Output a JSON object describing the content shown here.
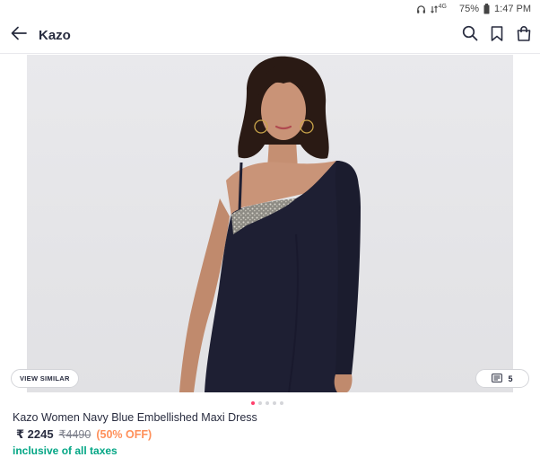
{
  "status_bar": {
    "network": "4G",
    "battery": "75%",
    "time": "1:47 PM"
  },
  "app_bar": {
    "title": "Kazo",
    "icons": [
      "back-arrow-icon",
      "search-icon",
      "bookmark-icon",
      "shopping-bag-icon"
    ]
  },
  "gallery": {
    "view_similar_label": "VIEW SIMILAR",
    "image_count": "5",
    "active_index": 0,
    "total_images": 5
  },
  "product": {
    "name": "Kazo Women Navy Blue Embellished Maxi Dress",
    "price": "₹ 2245",
    "mrp": "₹4490",
    "discount": "(50% OFF)",
    "tax_note": "inclusive of all taxes"
  },
  "colors": {
    "accent": "#ff3f6c",
    "discount": "#ff905a",
    "tax_note": "#03a685",
    "dress": "#1e1f33"
  }
}
